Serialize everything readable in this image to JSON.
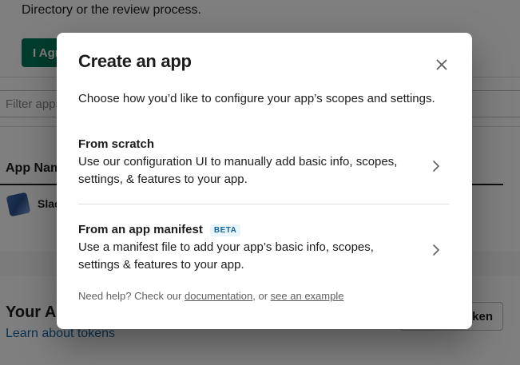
{
  "background": {
    "review_text": "Directory or the review process.",
    "agree_button_label": "I Agree",
    "filter_placeholder": "Filter apps",
    "column_header": "App Name",
    "app_row_name": "Slack",
    "section_title": "Your App Configuration Tokens",
    "learn_link": "Learn about tokens",
    "token_button_label": "Generate Token"
  },
  "modal": {
    "title": "Create an app",
    "close_icon": "close-icon",
    "intro": "Choose how you’d like to configure your app’s scopes and settings.",
    "options": [
      {
        "title": "From scratch",
        "description": "Use our configuration UI to manually add basic info, scopes, settings, & features to your app.",
        "icon": "chevron-right-icon"
      },
      {
        "title": "From an app manifest",
        "badge": "BETA",
        "description": "Use a manifest file to add your app’s basic info, scopes, settings & features to your app.",
        "icon": "chevron-right-icon"
      }
    ],
    "help": {
      "prefix": "Need help? Check our ",
      "documentation_link": "documentation",
      "middle": ", or ",
      "example_link": "see an example"
    }
  },
  "colors": {
    "agree_green": "#007a5a",
    "link_blue": "#1264a3",
    "overlay": "rgba(0,0,0,0.5)"
  }
}
